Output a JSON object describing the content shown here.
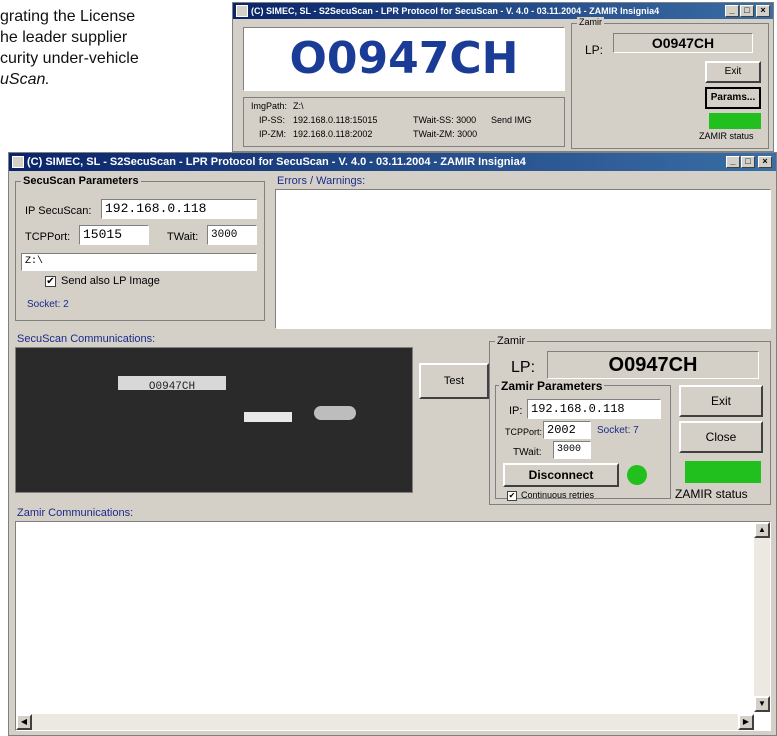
{
  "document": {
    "lines": [
      "grating the License",
      "he leader supplier",
      "curity under-vehicle"
    ],
    "last_line": "uScan."
  },
  "small_window": {
    "title": "(C) SIMEC, SL - S2SecuScan - LPR Protocol for SecuScan - V. 4.0 - 03.11.2004 - ZAMIR Insignia4",
    "plate_display": "O0947CH",
    "img_path_label": "ImgPath:",
    "img_path_value": "Z:\\",
    "ip_ss_label": "IP-SS:",
    "ip_ss_value": "192.168.0.118:15015",
    "ip_zm_label": "IP-ZM:",
    "ip_zm_value": "192.168.0.118:2002",
    "twait_ss": "TWait-SS: 3000",
    "twait_zm": "TWait-ZM: 3000",
    "send_img": "Send IMG",
    "zamir_group": "Zamir",
    "lp_label": "LP:",
    "lp_value": "O0947CH",
    "exit_button": "Exit",
    "params_button": "Params...",
    "zamir_status": "ZAMIR status",
    "status_color": "#22c01e"
  },
  "main_window": {
    "title": "(C) SIMEC, SL - S2SecuScan - LPR Protocol for SecuScan - V. 4.0 - 03.11.2004 - ZAMIR Insignia4",
    "secuscan_params": {
      "legend": "SecuScan Parameters",
      "ip_label": "IP SecuScan:",
      "ip_value": "192.168.0.118",
      "tcpport_label": "TCPPort:",
      "tcpport_value": "15015",
      "twait_label": "TWait:",
      "twait_value": "3000",
      "path_value": "Z:\\",
      "send_lp_label": "Send also LP Image",
      "socket_label": "Socket: 2"
    },
    "errors_label": "Errors / Warnings:",
    "secuscan_comm_label": "SecuScan Communications:",
    "plate_text": "O0947CH",
    "test_button": "Test",
    "zamir": {
      "legend": "Zamir",
      "lp_label": "LP:",
      "lp_value": "O0947CH",
      "params_legend": "Zamir Parameters",
      "ip_label": "IP:",
      "ip_value": "192.168.0.118",
      "tcpport_label": "TCPPort:",
      "tcpport_value": "2002",
      "socket_label": "Socket: 7",
      "twait_label": "TWait:",
      "twait_value": "3000",
      "disconnect_button": "Disconnect",
      "continuous_label": "Continuous retries",
      "exit_button": "Exit",
      "close_button": "Close",
      "status_label": "ZAMIR status",
      "status_color": "#22c01e"
    },
    "zamir_comm_label": "Zamir Communications:"
  }
}
